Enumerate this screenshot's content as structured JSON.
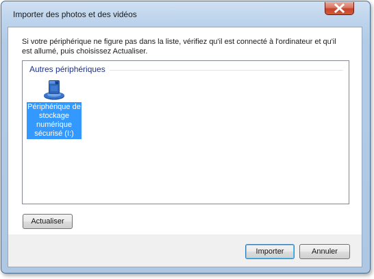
{
  "window": {
    "title": "Importer des photos et des vidéos"
  },
  "instructions": "Si votre périphérique ne figure pas dans la liste, vérifiez qu'il est connecté à l'ordinateur et qu'il est allumé, puis choisissez Actualiser.",
  "device_list": {
    "group_title": "Autres périphériques",
    "devices": [
      {
        "label": "Périphérique de stockage numérique sécurisé (I:)",
        "icon": "storage-device-icon",
        "selected": true
      }
    ]
  },
  "buttons": {
    "refresh": "Actualiser",
    "import": "Importer",
    "cancel": "Annuler"
  },
  "colors": {
    "selection": "#3399ff",
    "group_title": "#1e3287",
    "close_button": "#c7442a"
  }
}
